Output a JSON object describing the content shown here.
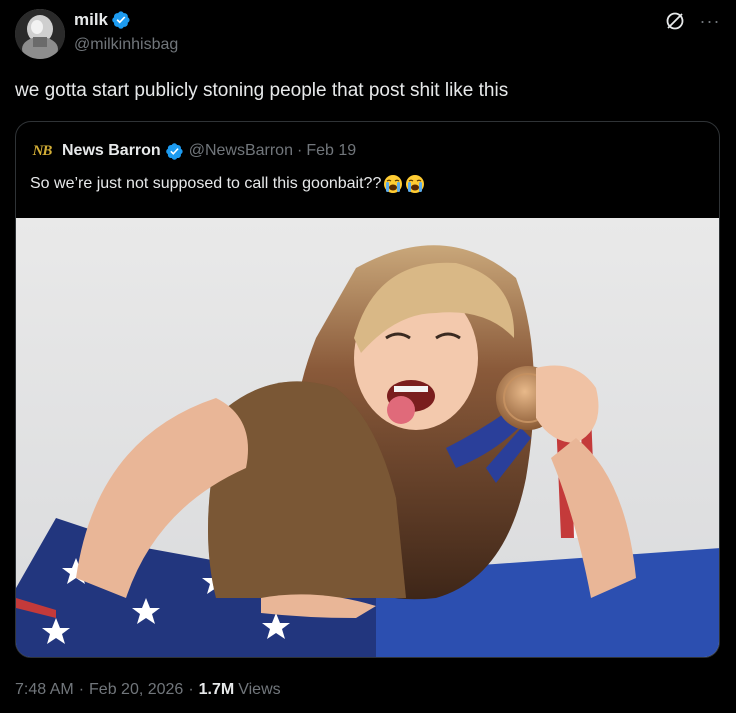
{
  "author": {
    "display_name": "milk",
    "handle": "@milkinhisbag",
    "verified": true
  },
  "actions": {
    "grok_icon": "grok-icon",
    "more_label": "···"
  },
  "tweet": {
    "text": "we gotta start publicly stoning people that post shit like this"
  },
  "quote": {
    "logo_text": "NB",
    "display_name": "News Barron",
    "handle": "@NewsBarron",
    "separator": "·",
    "date": "Feb 19",
    "text": "So we’re just not supposed to call this goonbait??",
    "emojis": [
      "loudly-crying-face",
      "loudly-crying-face"
    ]
  },
  "footer": {
    "time": "7:48 AM",
    "separator": "·",
    "date": "Feb 20, 2026",
    "separator2": "·",
    "views_count": "1.7M",
    "views_label": "Views"
  },
  "colors": {
    "background": "#000000",
    "text_primary": "#e7e9ea",
    "text_secondary": "#71767b",
    "border": "#2f3336",
    "verified_blue": "#1d9bf0",
    "nb_gold": "#d4af37"
  }
}
